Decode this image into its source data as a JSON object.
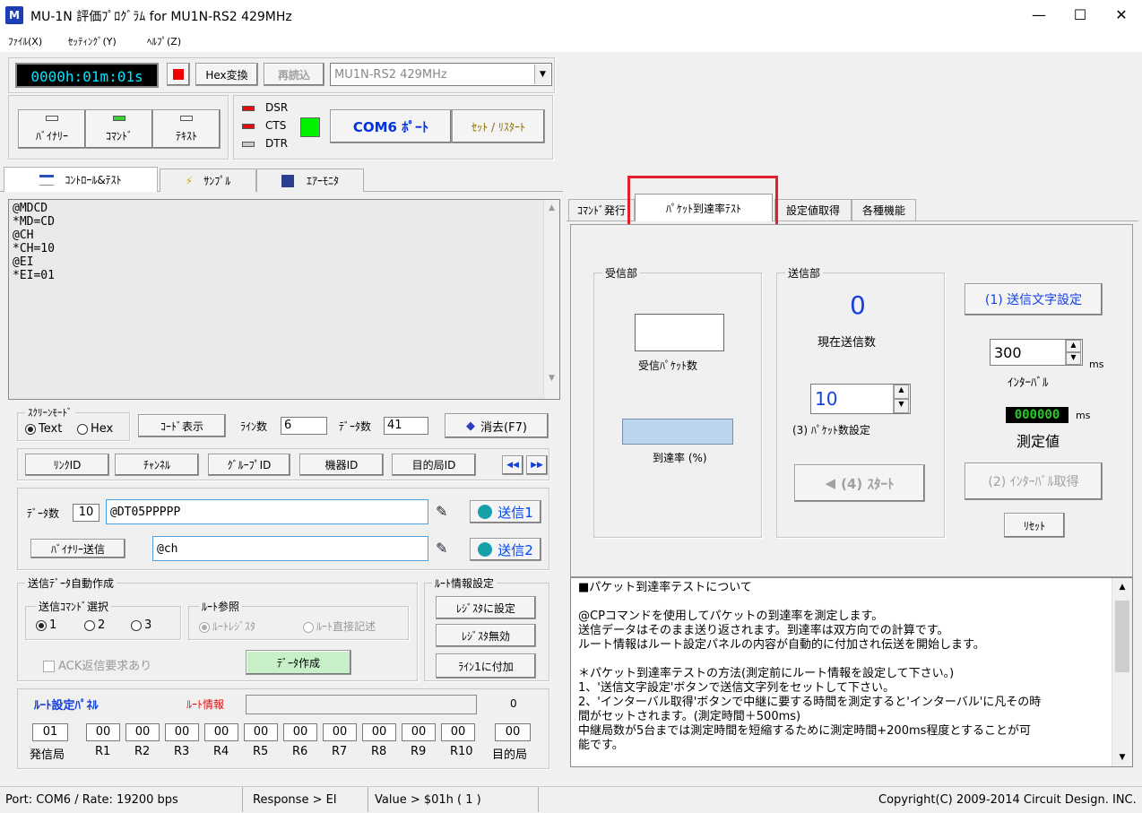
{
  "window": {
    "title": "MU-1N 評価ﾌﾟﾛｸﾞﾗﾑ for MU1N-RS2    429MHz",
    "icon_text": "M",
    "minimize": "—",
    "maximize": "☐",
    "close": "✕"
  },
  "menu": [
    {
      "label": "ﾌｧｲﾙ(X)"
    },
    {
      "label": "ｾｯﾃｨﾝｸﾞ(Y)"
    },
    {
      "label": "ﾍﾙﾌﾟ(Z)"
    }
  ],
  "toolbar": {
    "timer": "0000h:01m:01s",
    "hex_convert": "Hex変換",
    "reread": "再読込",
    "model_select": "MU1N-RS2      429MHz",
    "modes": [
      {
        "label": "ﾊﾞｲﾅﾘｰ",
        "led": "#c8c8c8"
      },
      {
        "label": "ｺﾏﾝﾄﾞ",
        "led": "#3ccf3c"
      },
      {
        "label": "ﾃｷｽﾄ",
        "led": "#c8c8c8"
      }
    ],
    "signals": [
      {
        "label": "DSR",
        "led": "#e01010"
      },
      {
        "label": "CTS",
        "led": "#e01010"
      },
      {
        "label": "DTR",
        "led": "#c8c8c8"
      }
    ],
    "com_port": "COM6 ﾎﾟｰﾄ",
    "set_restart": "ｾｯﾄ / ﾘｽﾀｰﾄ"
  },
  "main_tabs": [
    {
      "label": "ｺﾝﾄﾛｰﾙ&ﾃｽﾄ"
    },
    {
      "label": "ｻﾝﾌﾟﾙ"
    },
    {
      "label": "ｴｱｰﾓﾆﾀ"
    }
  ],
  "terminal": {
    "lines": [
      "@MDCD",
      "*MD=CD",
      "@CH",
      "*CH=10",
      "@EI",
      "*EI=01"
    ]
  },
  "screen_mode": {
    "title": "ｽｸﾘｰﾝﾓｰﾄﾞ",
    "text": "Text",
    "hex": "Hex",
    "code_display": "ｺｰﾄﾞ表示",
    "lines_label": "ﾗｲﾝ数",
    "lines_value": "6",
    "data_count_label": "ﾃﾞｰﾀ数",
    "data_count_value": "41",
    "clear": "消去(F7)"
  },
  "id_buttons": [
    {
      "label": "ﾘﾝｸID"
    },
    {
      "label": "ﾁｬﾝﾈﾙ"
    },
    {
      "label": "ｸﾞﾙｰﾌﾟID"
    },
    {
      "label": "機器ID"
    },
    {
      "label": "目的局ID"
    }
  ],
  "nav": {
    "prev": "◀◀",
    "next": "▶▶"
  },
  "send": {
    "data_count_label": "ﾃﾞｰﾀ数",
    "data_count_value": "10",
    "cmd1": "@DT05PPPPP",
    "send1": "送信1",
    "binary_send": "ﾊﾞｲﾅﾘｰ送信",
    "cmd2": "@ch",
    "send2": "送信2"
  },
  "auto": {
    "title": "送信ﾃﾞｰﾀ自動作成",
    "cmd_select": "送信ｺﾏﾝﾄﾞ選択",
    "opt1": "1",
    "opt2": "2",
    "opt3": "3",
    "route_ref": "ﾙｰﾄ参照",
    "route_register": "ﾙｰﾄﾚｼﾞｽﾀ",
    "route_direct": "ﾙｰﾄ直接記述",
    "ack": "ACK返信要求あり",
    "make_data": "ﾃﾞｰﾀ作成"
  },
  "route_info": {
    "title": "ﾙｰﾄ情報設定",
    "set_register": "ﾚｼﾞｽﾀに設定",
    "disable_register": "ﾚｼﾞｽﾀ無効",
    "add_line1": "ﾗｲﾝ1に付加"
  },
  "route_panel": {
    "title": "ﾙｰﾄ設定ﾊﾟﾈﾙ",
    "info_label": "ﾙｰﾄ情報",
    "count": "0",
    "cells": [
      {
        "value": "01",
        "label": "発信局"
      },
      {
        "value": "00",
        "label": "R1"
      },
      {
        "value": "00",
        "label": "R2"
      },
      {
        "value": "00",
        "label": "R3"
      },
      {
        "value": "00",
        "label": "R4"
      },
      {
        "value": "00",
        "label": "R5"
      },
      {
        "value": "00",
        "label": "R6"
      },
      {
        "value": "00",
        "label": "R7"
      },
      {
        "value": "00",
        "label": "R8"
      },
      {
        "value": "00",
        "label": "R9"
      },
      {
        "value": "00",
        "label": "R10"
      },
      {
        "value": "00",
        "label": "目的局"
      }
    ]
  },
  "right_tabs": [
    {
      "label": "ｺﾏﾝﾄﾞ発行"
    },
    {
      "label": "ﾊﾟｹｯﾄ到達率ﾃｽﾄ"
    },
    {
      "label": "設定値取得"
    },
    {
      "label": "各種機能"
    }
  ],
  "packet_test": {
    "receiver_title": "受信部",
    "received_packets": "受信ﾊﾟｹｯﾄ数",
    "arrival_rate": "到達率 (%)",
    "sender_title": "送信部",
    "current_sent_value": "0",
    "current_sent": "現在送信数",
    "packet_count_value": "10",
    "packet_count_label": "(3) ﾊﾟｹｯﾄ数設定",
    "start": "(4) ｽﾀｰﾄ",
    "send_text_set": "(1) 送信文字設定",
    "interval_value": "300",
    "ms1": "ms",
    "interval_label": "ｲﾝﾀｰﾊﾞﾙ",
    "measured_value": "000000",
    "ms2": "ms",
    "measured_label": "測定値",
    "get_interval": "(2) ｲﾝﾀｰﾊﾞﾙ取得",
    "reset": "ﾘｾｯﾄ"
  },
  "help_text": {
    "lines": [
      "■パケット到達率テストについて",
      "",
      "@CPコマンドを使用してパケットの到達率を測定します。",
      "送信データはそのまま送り返されます。到達率は双方向での計算です。",
      "ルート情報はルート設定パネルの内容が自動的に付加され伝送を開始します。",
      "",
      "＊パケット到達率テストの方法(測定前にルート情報を設定して下さい。)",
      "1、'送信文字設定'ボタンで送信文字列をセットして下さい。",
      "2、'インターバル取得'ボタンで中継に要する時間を測定すると'インターバル'に凡その時",
      "間がセットされます。(測定時間＋500ms)",
      "中継局数が5台までは測定時間を短縮するために測定時間+200ms程度とすることが可",
      "能です。"
    ]
  },
  "status": {
    "port": "Port: COM6 / Rate: 19200 bps",
    "response": "Response > EI",
    "value": "Value > $01h ( 1 )",
    "copyright": "Copyright(C) 2009-2014 Circuit Design. INC."
  },
  "colors": {
    "highlight": "#e0202a",
    "timer_bg": "#000000",
    "timer_fg": "#00e5ff",
    "send_blue": "#0044ee"
  }
}
